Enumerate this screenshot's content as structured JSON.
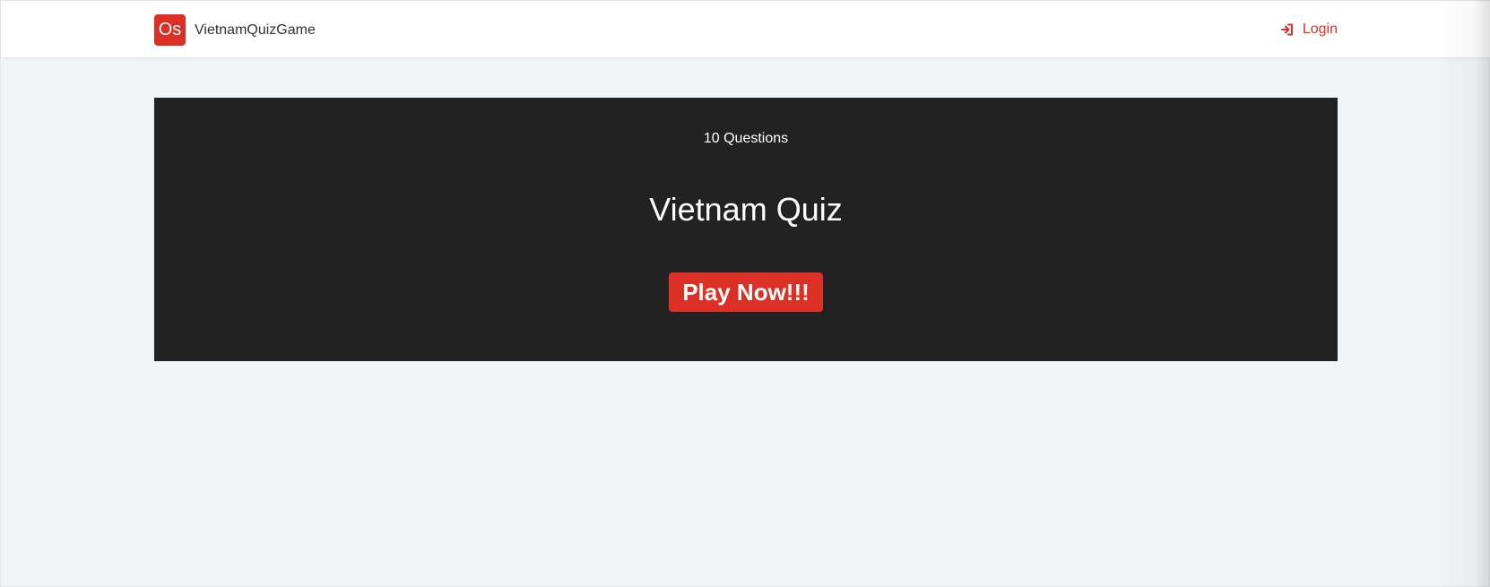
{
  "brand": {
    "logo_text": "Os",
    "name": "VietnamQuizGame"
  },
  "nav": {
    "login_label": "Login",
    "login_icon": "sign-in-icon"
  },
  "hero": {
    "question_count": "10 Questions",
    "title": "Vietnam Quiz",
    "play_label": "Play Now!!!"
  },
  "colors": {
    "accent": "#dc2f26",
    "hero_background": "#222222",
    "page_background": "#f0f4f7",
    "nav_background": "#ffffff"
  }
}
